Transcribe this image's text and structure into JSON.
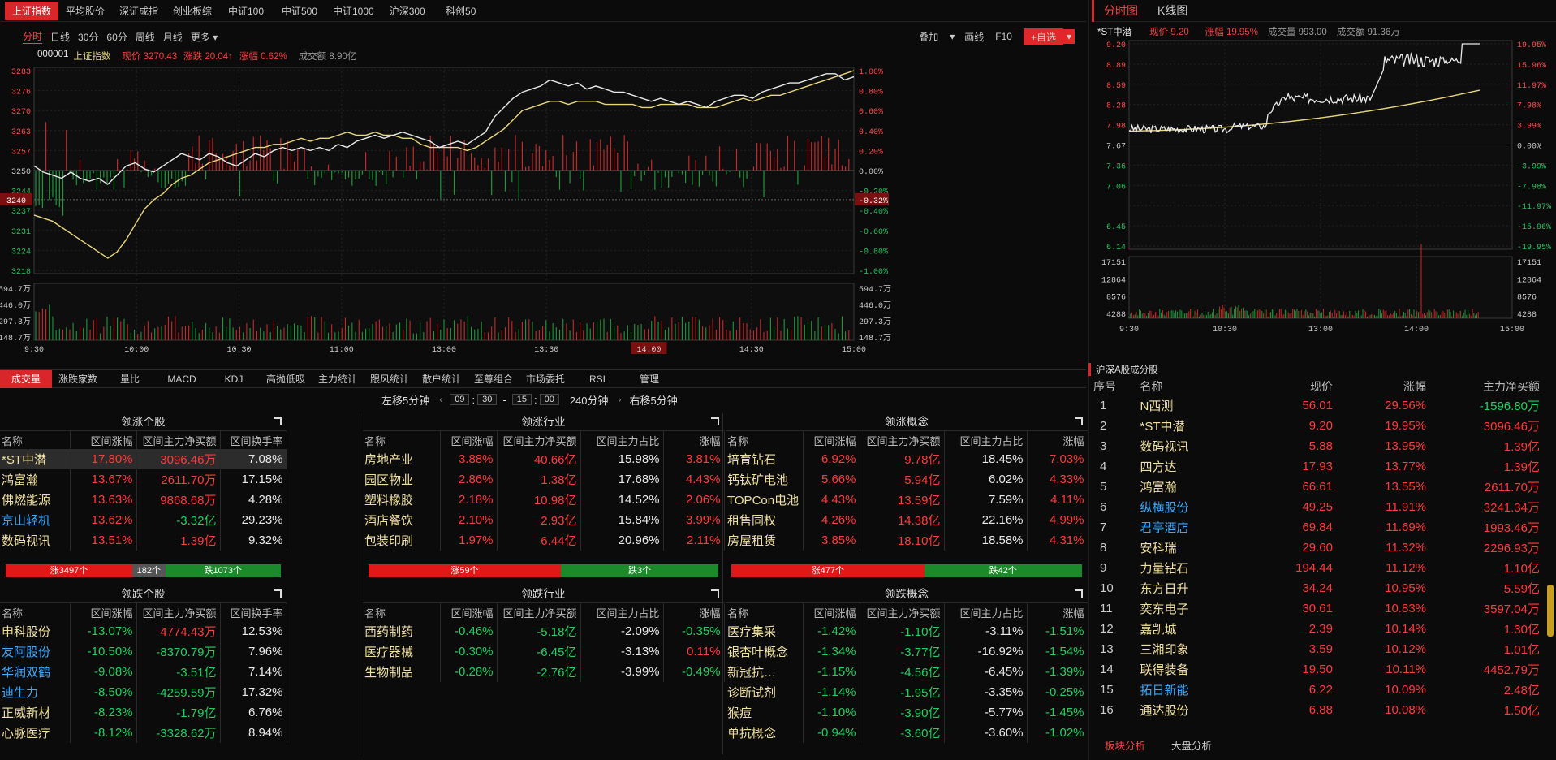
{
  "index_tabs": [
    "上证指数",
    "平均股价",
    "深证成指",
    "创业板综",
    "中证100",
    "中证500",
    "中证1000",
    "沪深300",
    "科创50"
  ],
  "periods": [
    "分时",
    "日线",
    "30分",
    "60分",
    "周线",
    "月线",
    "更多 ▾"
  ],
  "toolbar": {
    "overlay": "叠加",
    "overlay_dd": "▾",
    "draw": "画线",
    "f10": "F10",
    "add": "+自选",
    "add_dd": "▾"
  },
  "main_info": {
    "code": "000001",
    "name": "上证指数",
    "price_label": "现价 3270.43",
    "change_label": "涨跌 20.04↑",
    "pct_label": "涨幅 0.62%",
    "amount_label": "成交额 8.90亿"
  },
  "main_chart": {
    "y_left": [
      "3283",
      "3276",
      "3270",
      "3263",
      "3257",
      "3250",
      "3244",
      "3237",
      "3231",
      "3224",
      "3218"
    ],
    "y_right": [
      "1.00%",
      "0.80%",
      "0.60%",
      "0.40%",
      "0.20%",
      "0.00%",
      "-0.20%",
      "-0.40%",
      "-0.60%",
      "-0.80%",
      "-1.00%"
    ],
    "cursor_left": "3240",
    "cursor_right": "-0.32%",
    "vol_left": [
      "594.7万",
      "446.0万",
      "297.3万",
      "148.7万"
    ],
    "vol_right": [
      "594.7万",
      "446.0万",
      "297.3万",
      "148.7万"
    ],
    "x_labels": [
      "9:30",
      "10:00",
      "10:30",
      "11:00",
      "13:00",
      "13:30",
      "14:00",
      "14:30",
      "15:00"
    ],
    "x_highlight": "14:00",
    "price_line": [
      3252,
      3250,
      3249,
      3248,
      3250,
      3248,
      3247,
      3248,
      3246,
      3249,
      3252,
      3253,
      3251,
      3250,
      3252,
      3254,
      3256,
      3255,
      3254,
      3256,
      3255,
      3253,
      3252,
      3254,
      3256,
      3255,
      3257,
      3258,
      3257,
      3258,
      3257,
      3258,
      3257,
      3259,
      3258,
      3260,
      3261,
      3262,
      3261,
      3262,
      3263,
      3262,
      3261,
      3260,
      3258,
      3259,
      3260,
      3259,
      3261,
      3263,
      3268,
      3271,
      3274,
      3276,
      3277,
      3278,
      3280,
      3279,
      3278,
      3279,
      3277,
      3278,
      3277,
      3276,
      3276,
      3275,
      3274,
      3273,
      3274,
      3273,
      3272,
      3273,
      3272,
      3271,
      3273,
      3274,
      3275,
      3275,
      3274,
      3276,
      3277,
      3278,
      3279,
      3279,
      3280,
      3281,
      3282,
      3282,
      3280,
      3281
    ],
    "avg_line": [
      3236,
      3235,
      3234,
      3232,
      3230,
      3228,
      3226,
      3224,
      3222,
      3224,
      3228,
      3233,
      3238,
      3241,
      3243,
      3246,
      3248,
      3249,
      3251,
      3253,
      3254,
      3255,
      3256,
      3257,
      3258,
      3258,
      3259,
      3259,
      3260,
      3261,
      3260,
      3261,
      3261,
      3262,
      3263,
      3262,
      3262,
      3263,
      3262,
      3262,
      3261,
      3261,
      3259,
      3258,
      3258,
      3258,
      3258,
      3257,
      3258,
      3260,
      3262,
      3264,
      3267,
      3270,
      3271,
      3272,
      3273,
      3273,
      3272,
      3273,
      3273,
      3273,
      3272,
      3272,
      3272,
      3272,
      3271,
      3271,
      3272,
      3272,
      3272,
      3272,
      3271,
      3271,
      3271,
      3272,
      3273,
      3274,
      3273,
      3274,
      3275,
      3275,
      3276,
      3277,
      3278,
      3279,
      3280,
      3281,
      3282,
      3283
    ]
  },
  "indicator_tabs": [
    "成交量",
    "涨跌家数",
    "量比",
    "MACD",
    "KDJ",
    "高抛低吸",
    "主力统计",
    "跟风统计",
    "散户统计",
    "至尊组合",
    "市场委托",
    "RSI",
    "管理"
  ],
  "shift": {
    "left": "左移5分钟",
    "h1": "09",
    "m1": "30",
    "dash": "-",
    "h2": "15",
    "m2": "00",
    "dur": "240分钟",
    "right": "右移5分钟",
    "lt": "‹",
    "gt": "›"
  },
  "panels": {
    "up_stocks": {
      "title": "领涨个股",
      "headers": [
        "名称",
        "区间涨幅",
        "区间主力净买额",
        "区间换手率"
      ],
      "rows": [
        [
          "*ST中潜",
          "17.80%",
          "3096.46万",
          "7.08%"
        ],
        [
          "鸿富瀚",
          "13.67%",
          "2611.70万",
          "17.15%"
        ],
        [
          "佛燃能源",
          "13.63%",
          "9868.68万",
          "4.28%"
        ],
        [
          "京山轻机",
          "13.62%",
          "-3.32亿",
          "29.23%"
        ],
        [
          "数码视讯",
          "13.51%",
          "1.39亿",
          "9.32%"
        ]
      ],
      "breadth": {
        "up": "涨3497个",
        "flat": "182个",
        "down": "跌1073个"
      }
    },
    "up_ind": {
      "title": "领涨行业",
      "headers": [
        "名称",
        "区间涨幅",
        "区间主力净买额",
        "区间主力占比",
        "涨幅"
      ],
      "rows": [
        [
          "房地产业",
          "3.88%",
          "40.66亿",
          "15.98%",
          "3.81%"
        ],
        [
          "园区物业",
          "2.86%",
          "1.38亿",
          "17.68%",
          "4.43%"
        ],
        [
          "塑料橡胶",
          "2.18%",
          "10.98亿",
          "14.52%",
          "2.06%"
        ],
        [
          "酒店餐饮",
          "2.10%",
          "2.93亿",
          "15.84%",
          "3.99%"
        ],
        [
          "包装印刷",
          "1.97%",
          "6.44亿",
          "20.96%",
          "2.11%"
        ]
      ],
      "breadth": {
        "up": "涨59个",
        "down": "跌3个"
      }
    },
    "up_con": {
      "title": "领涨概念",
      "headers": [
        "名称",
        "区间涨幅",
        "区间主力净买额",
        "区间主力占比",
        "涨幅"
      ],
      "rows": [
        [
          "培育钻石",
          "6.92%",
          "9.78亿",
          "18.45%",
          "7.03%"
        ],
        [
          "钙钛矿电池",
          "5.66%",
          "5.94亿",
          "6.02%",
          "4.33%"
        ],
        [
          "TOPCon电池",
          "4.43%",
          "13.59亿",
          "7.59%",
          "4.11%"
        ],
        [
          "租售同权",
          "4.26%",
          "14.38亿",
          "22.16%",
          "4.99%"
        ],
        [
          "房屋租赁",
          "3.85%",
          "18.10亿",
          "18.58%",
          "4.31%"
        ]
      ],
      "breadth": {
        "up": "涨477个",
        "down": "跌42个"
      }
    },
    "dn_stocks": {
      "title": "领跌个股",
      "headers": [
        "名称",
        "区间涨幅",
        "区间主力净买额",
        "区间换手率"
      ],
      "rows": [
        [
          "申科股份",
          "-13.07%",
          "4774.43万",
          "12.53%"
        ],
        [
          "友阿股份",
          "-10.50%",
          "-8370.79万",
          "7.96%"
        ],
        [
          "华润双鹤",
          "-9.08%",
          "-3.51亿",
          "7.14%"
        ],
        [
          "迪生力",
          "-8.50%",
          "-4259.59万",
          "17.32%"
        ],
        [
          "正威新材",
          "-8.23%",
          "-1.79亿",
          "6.76%"
        ],
        [
          "心脉医疗",
          "-8.12%",
          "-3328.62万",
          "8.94%"
        ]
      ]
    },
    "dn_ind": {
      "title": "领跌行业",
      "headers": [
        "名称",
        "区间涨幅",
        "区间主力净买额",
        "区间主力占比",
        "涨幅"
      ],
      "rows": [
        [
          "西药制药",
          "-0.46%",
          "-5.18亿",
          "-2.09%",
          "-0.35%"
        ],
        [
          "医疗器械",
          "-0.30%",
          "-6.45亿",
          "-3.13%",
          "0.11%"
        ],
        [
          "生物制品",
          "-0.28%",
          "-2.76亿",
          "-3.99%",
          "-0.49%"
        ]
      ]
    },
    "dn_con": {
      "title": "领跌概念",
      "headers": [
        "名称",
        "区间涨幅",
        "区间主力净买额",
        "区间主力占比",
        "涨幅"
      ],
      "rows": [
        [
          "医疗集采",
          "-1.42%",
          "-1.10亿",
          "-3.11%",
          "-1.51%"
        ],
        [
          "银杏叶概念",
          "-1.34%",
          "-3.77亿",
          "-16.92%",
          "-1.54%"
        ],
        [
          "新冠抗…",
          "-1.15%",
          "-4.56亿",
          "-6.45%",
          "-1.39%"
        ],
        [
          "诊断试剂",
          "-1.14%",
          "-1.95亿",
          "-3.35%",
          "-0.25%"
        ],
        [
          "猴痘",
          "-1.10%",
          "-3.90亿",
          "-5.77%",
          "-1.45%"
        ],
        [
          "单抗概念",
          "-0.94%",
          "-3.60亿",
          "-3.60%",
          "-1.02%"
        ]
      ]
    }
  },
  "right_tabs": [
    "分时图",
    "K线图"
  ],
  "right_info": {
    "name": "*ST中潜",
    "price": "现价 9.20",
    "pct": "涨幅 19.95%",
    "vol": "成交量 993.00",
    "amount": "成交额 91.36万"
  },
  "right_chart": {
    "y_left": [
      "9.20",
      "8.89",
      "8.59",
      "8.28",
      "7.98",
      "7.67",
      "7.36",
      "7.06",
      "6.45",
      "6.14"
    ],
    "y_right": [
      "19.95%",
      "15.96%",
      "11.97%",
      "7.98%",
      "3.99%",
      "0.00%",
      "-3.99%",
      "-7.98%",
      "-11.97%",
      "-15.96%",
      "-19.95%"
    ],
    "vol_left": [
      "17151",
      "12864",
      "8576",
      "4288"
    ],
    "vol_right": [
      "17151",
      "12864",
      "8576",
      "4288"
    ],
    "x_labels": [
      "9:30",
      "10:30",
      "13:00",
      "14:00",
      "15:00"
    ]
  },
  "right_list": {
    "title": "沪深A股成分股",
    "headers": [
      "序号",
      "名称",
      "现价",
      "涨幅",
      "主力净买额"
    ],
    "rows": [
      [
        "1",
        "N西测",
        "56.01",
        "29.56%",
        "-1596.80万"
      ],
      [
        "2",
        "*ST中潜",
        "9.20",
        "19.95%",
        "3096.46万"
      ],
      [
        "3",
        "数码视讯",
        "5.88",
        "13.95%",
        "1.39亿"
      ],
      [
        "4",
        "四方达",
        "17.93",
        "13.77%",
        "1.39亿"
      ],
      [
        "5",
        "鸿富瀚",
        "66.61",
        "13.55%",
        "2611.70万"
      ],
      [
        "6",
        "纵横股份",
        "49.25",
        "11.91%",
        "3241.34万"
      ],
      [
        "7",
        "君亭酒店",
        "69.84",
        "11.69%",
        "1993.46万"
      ],
      [
        "8",
        "安科瑞",
        "29.60",
        "11.32%",
        "2296.93万"
      ],
      [
        "9",
        "力量钻石",
        "194.44",
        "11.12%",
        "1.10亿"
      ],
      [
        "10",
        "东方日升",
        "34.24",
        "10.95%",
        "5.59亿"
      ],
      [
        "11",
        "奕东电子",
        "30.61",
        "10.83%",
        "3597.04万"
      ],
      [
        "12",
        "嘉凯城",
        "2.39",
        "10.14%",
        "1.30亿"
      ],
      [
        "13",
        "三湘印象",
        "3.59",
        "10.12%",
        "1.01亿"
      ],
      [
        "14",
        "联得装备",
        "19.50",
        "10.11%",
        "4452.79万"
      ],
      [
        "15",
        "拓日新能",
        "6.22",
        "10.09%",
        "2.48亿"
      ],
      [
        "16",
        "通达股份",
        "6.88",
        "10.08%",
        "1.50亿"
      ]
    ]
  },
  "right_footer": [
    "板块分析",
    "大盘分析"
  ]
}
